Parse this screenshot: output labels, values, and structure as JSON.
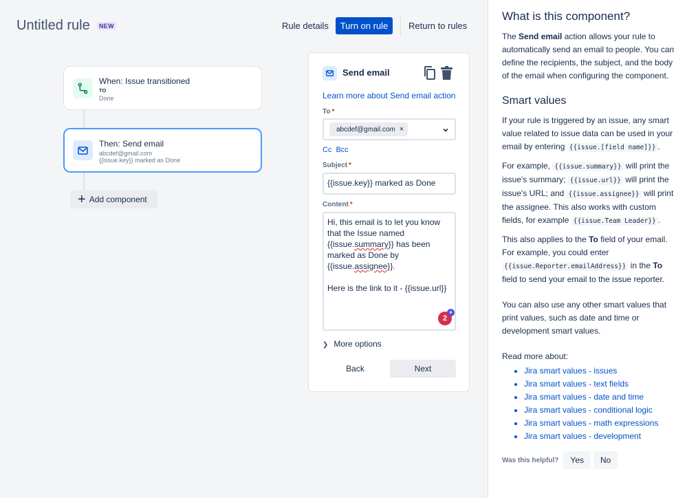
{
  "header": {
    "title": "Untitled rule",
    "badge": "NEW",
    "rule_details": "Rule details",
    "turn_on": "Turn on rule",
    "return": "Return to rules"
  },
  "flow": {
    "trigger": {
      "title": "When: Issue transitioned",
      "sub_label": "TO",
      "sub_value": "Done",
      "icon": "branch-icon"
    },
    "action": {
      "title": "Then: Send email",
      "line1": "abcdef@gmail.com",
      "line2": "{{issue.key}} marked as Done",
      "icon": "mail-icon"
    },
    "add_component": "Add component"
  },
  "config": {
    "title": "Send email",
    "learn_more": "Learn more about Send email action",
    "to_label": "To",
    "to_value": "abcdef@gmail.com",
    "cc": "Cc",
    "bcc": "Bcc",
    "subject_label": "Subject",
    "subject_value": "{{issue.key}} marked as Done",
    "content_label": "Content",
    "content_l1": "Hi, this email is to let you know that the Issue named {{issue.",
    "content_summary": "summary",
    "content_l2": "}} has been marked as Done by {{issue.",
    "content_assignee": "assignee",
    "content_l3": "}}.",
    "content_l4": "Here is the link to it - {{issue.url}}",
    "grammarly_count": "2",
    "more_options": "More options",
    "back": "Back",
    "next": "Next"
  },
  "help": {
    "title": "What is this component?",
    "p1_a": "The ",
    "p1_bold": "Send email",
    "p1_b": " action allows your rule to automatically send an email to people. You can define the recipients, the subject, and the body of the email when configuring the component.",
    "smart_title": "Smart values",
    "p2_a": "If your rule is triggered by an issue, any smart value related to issue data can be used in your email by entering ",
    "p2_code": "{{issue.[field name]}}",
    "p2_b": ".",
    "p3_a": "For example, ",
    "p3_code1": "{{issue.summary}}",
    "p3_b": " will print the issue's summary; ",
    "p3_code2": "{{issue.url}}",
    "p3_c": " will print the issue's URL; and ",
    "p3_code3": "{{issue.assignee}}",
    "p3_d": " will print the assignee. This also works with custom fields, for example ",
    "p3_code4": "{{issue.Team Leader}}",
    "p3_e": ".",
    "p4_a": "This also applies to the ",
    "p4_bold1": "To",
    "p4_b": " field of your email. For example, you could enter ",
    "p4_code": "{{issue.Reporter.emailAddress}}",
    "p4_c": " in the ",
    "p4_bold2": "To",
    "p4_d": " field to send your email to the issue reporter.",
    "p5": "You can also use any other smart values that print values, such as date and time or development smart values.",
    "read_more": "Read more about:",
    "links": [
      "Jira smart values - issues",
      "Jira smart values - text fields",
      "Jira smart values - date and time",
      "Jira smart values - conditional logic",
      "Jira smart values - math expressions",
      "Jira smart values - development"
    ],
    "helpful_label": "Was this helpful?",
    "yes": "Yes",
    "no": "No"
  }
}
